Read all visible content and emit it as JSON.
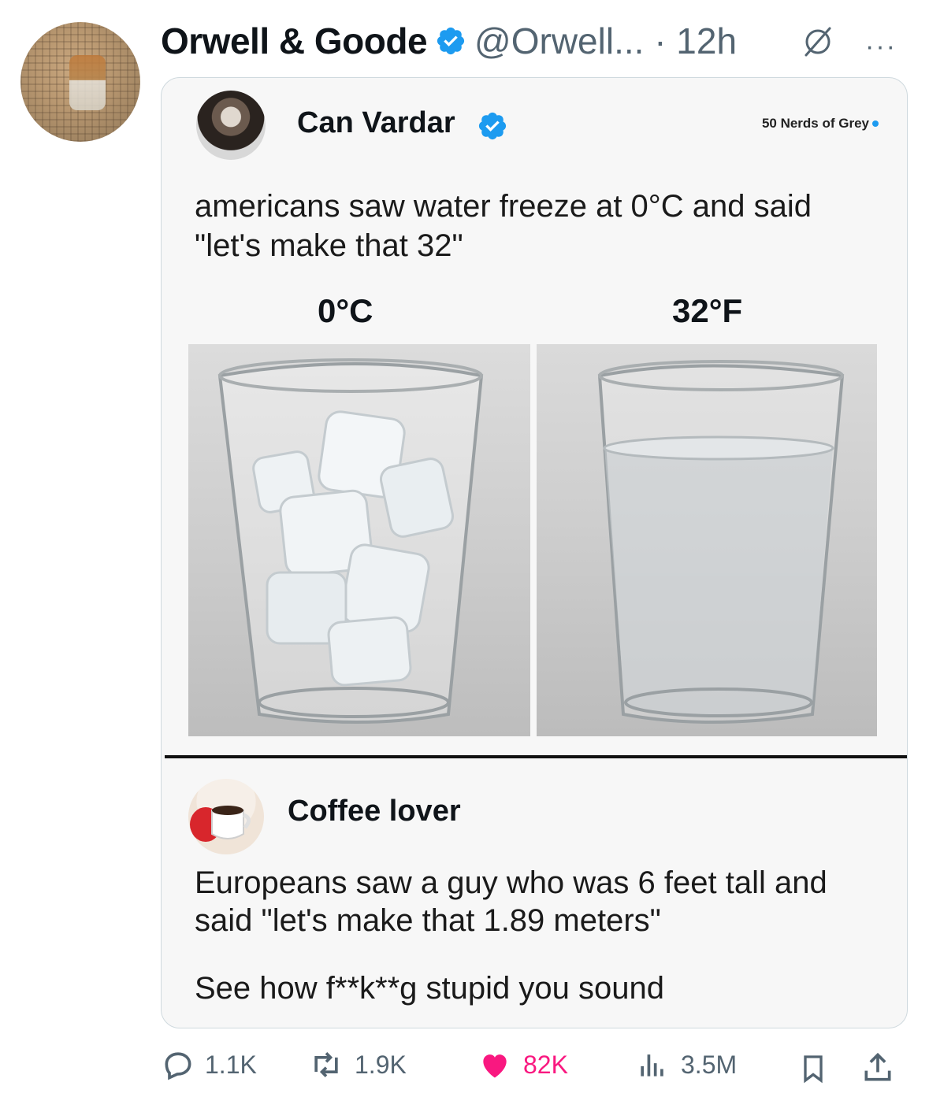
{
  "post": {
    "author_name": "Orwell & Goode",
    "handle_time": "@Orwell... · 12h",
    "more": "···"
  },
  "quoted": {
    "author_name": "Can Vardar",
    "watermark": "50 Nerds of Grey",
    "text": "americans saw water freeze at 0°C and said \"let's make that 32\"",
    "label_left": "0°C",
    "label_right": "32°F",
    "reply_author": "Coffee lover",
    "reply_text": "Europeans saw a guy who was 6 feet tall and said \"let's make that 1.89 meters\"",
    "reply_text2": "See how f**k**g stupid you sound"
  },
  "actions": {
    "replies": "1.1K",
    "reposts": "1.9K",
    "likes": "82K",
    "views": "3.5M"
  },
  "colors": {
    "verified": "#1d9bf0",
    "like": "#f91880",
    "muted": "#536471"
  }
}
